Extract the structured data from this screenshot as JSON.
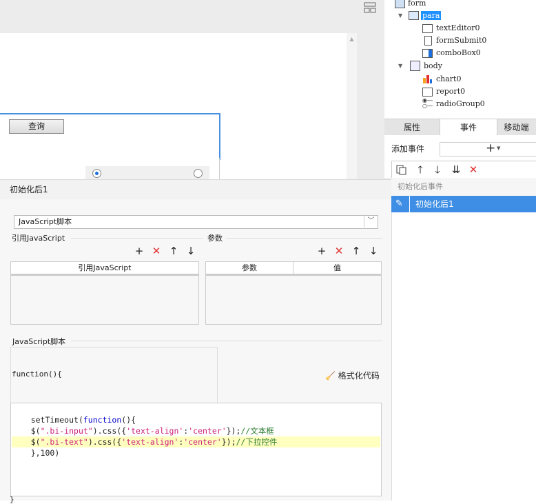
{
  "designer": {
    "query_button": "查询"
  },
  "tree": {
    "items": [
      {
        "label": "form",
        "icon": "form-icon"
      },
      {
        "label": "para",
        "icon": "para-icon"
      },
      {
        "label": "textEditor0",
        "icon": "text-editor-icon"
      },
      {
        "label": "formSubmit0",
        "icon": "form-submit-icon"
      },
      {
        "label": "comboBox0",
        "icon": "combobox-icon"
      },
      {
        "label": "body",
        "icon": "body-icon"
      },
      {
        "label": "chart0",
        "icon": "chart-icon"
      },
      {
        "label": "report0",
        "icon": "report-icon"
      },
      {
        "label": "radioGroup0",
        "icon": "radio-group-icon"
      }
    ]
  },
  "right_panel": {
    "tabs": [
      "属性",
      "事件",
      "移动端"
    ],
    "active_tab": "事件",
    "add_event_label": "添加事件",
    "event_group": "初始化后事件",
    "event_item": "初始化后1"
  },
  "dialog": {
    "title": "初始化后1",
    "script_type": "JavaScript脚本",
    "ref_js_label": "引用JavaScript",
    "params_label": "参数",
    "ref_js_column": "引用JavaScript",
    "param_columns": [
      "参数",
      "值"
    ],
    "js_script_label": "JavaScript脚本",
    "function_header": "function(){",
    "format_button": "格式化代码",
    "code_lines": [
      "setTimeout(function(){",
      "$(\".bi-input\").css({'text-align':'center'});//文本框",
      "$(\".bi-text\").css({'text-align':'center'});//下拉控件",
      "},100)"
    ],
    "closing": "}"
  },
  "colors": {
    "selection": "#3d8ee4",
    "highlight_line": "#ffffc0",
    "delete_red": "#e03030",
    "keyword": "#0000cc",
    "string": "#cc1f7a",
    "comment": "#2e7d32"
  }
}
